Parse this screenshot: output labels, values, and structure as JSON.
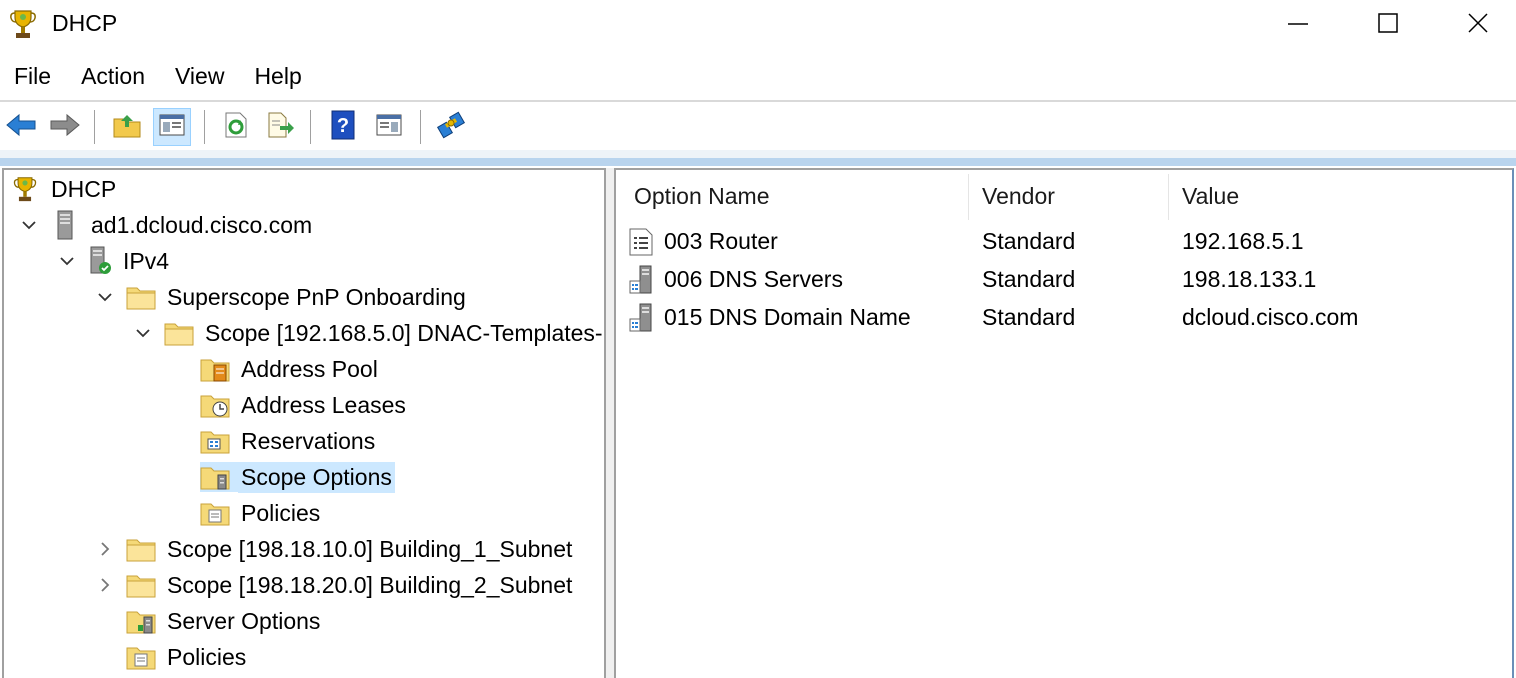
{
  "window": {
    "title": "DHCP",
    "app_icon": "dhcp-trophy-icon",
    "controls": [
      "minimize-icon",
      "maximize-icon",
      "close-icon"
    ]
  },
  "menu": {
    "file": "File",
    "action": "Action",
    "view": "View",
    "help": "Help"
  },
  "toolbar": {
    "buttons": [
      "back-icon",
      "forward-icon",
      "up-folder-icon",
      "show-hide-tree-icon",
      "refresh-icon",
      "export-list-icon",
      "help-icon",
      "show-hide-action-pane-icon",
      "server-config-icon"
    ]
  },
  "tree": {
    "root": "DHCP",
    "server": "ad1.dcloud.cisco.com",
    "ipv4": "IPv4",
    "superscope": "Superscope PnP Onboarding",
    "scope_main": "Scope [192.168.5.0] DNAC-Templates-",
    "address_pool": "Address Pool",
    "address_leases": "Address Leases",
    "reservations": "Reservations",
    "scope_options": "Scope Options",
    "policies_scope": "Policies",
    "scope_b1": "Scope [198.18.10.0] Building_1_Subnet",
    "scope_b2": "Scope [198.18.20.0] Building_2_Subnet",
    "server_options": "Server Options",
    "policies_server": "Policies"
  },
  "list": {
    "columns": {
      "option_name": "Option Name",
      "vendor": "Vendor",
      "value": "Value"
    },
    "rows": [
      {
        "name": "003 Router",
        "vendor": "Standard",
        "value": "192.168.5.1"
      },
      {
        "name": "006 DNS Servers",
        "vendor": "Standard",
        "value": "198.18.133.1"
      },
      {
        "name": "015 DNS Domain Name",
        "vendor": "Standard",
        "value": "dcloud.cisco.com"
      }
    ]
  },
  "colors": {
    "selection": "#cce8ff",
    "folder": "#f2c94c",
    "toolbar_accent": "#1e6ecf"
  }
}
